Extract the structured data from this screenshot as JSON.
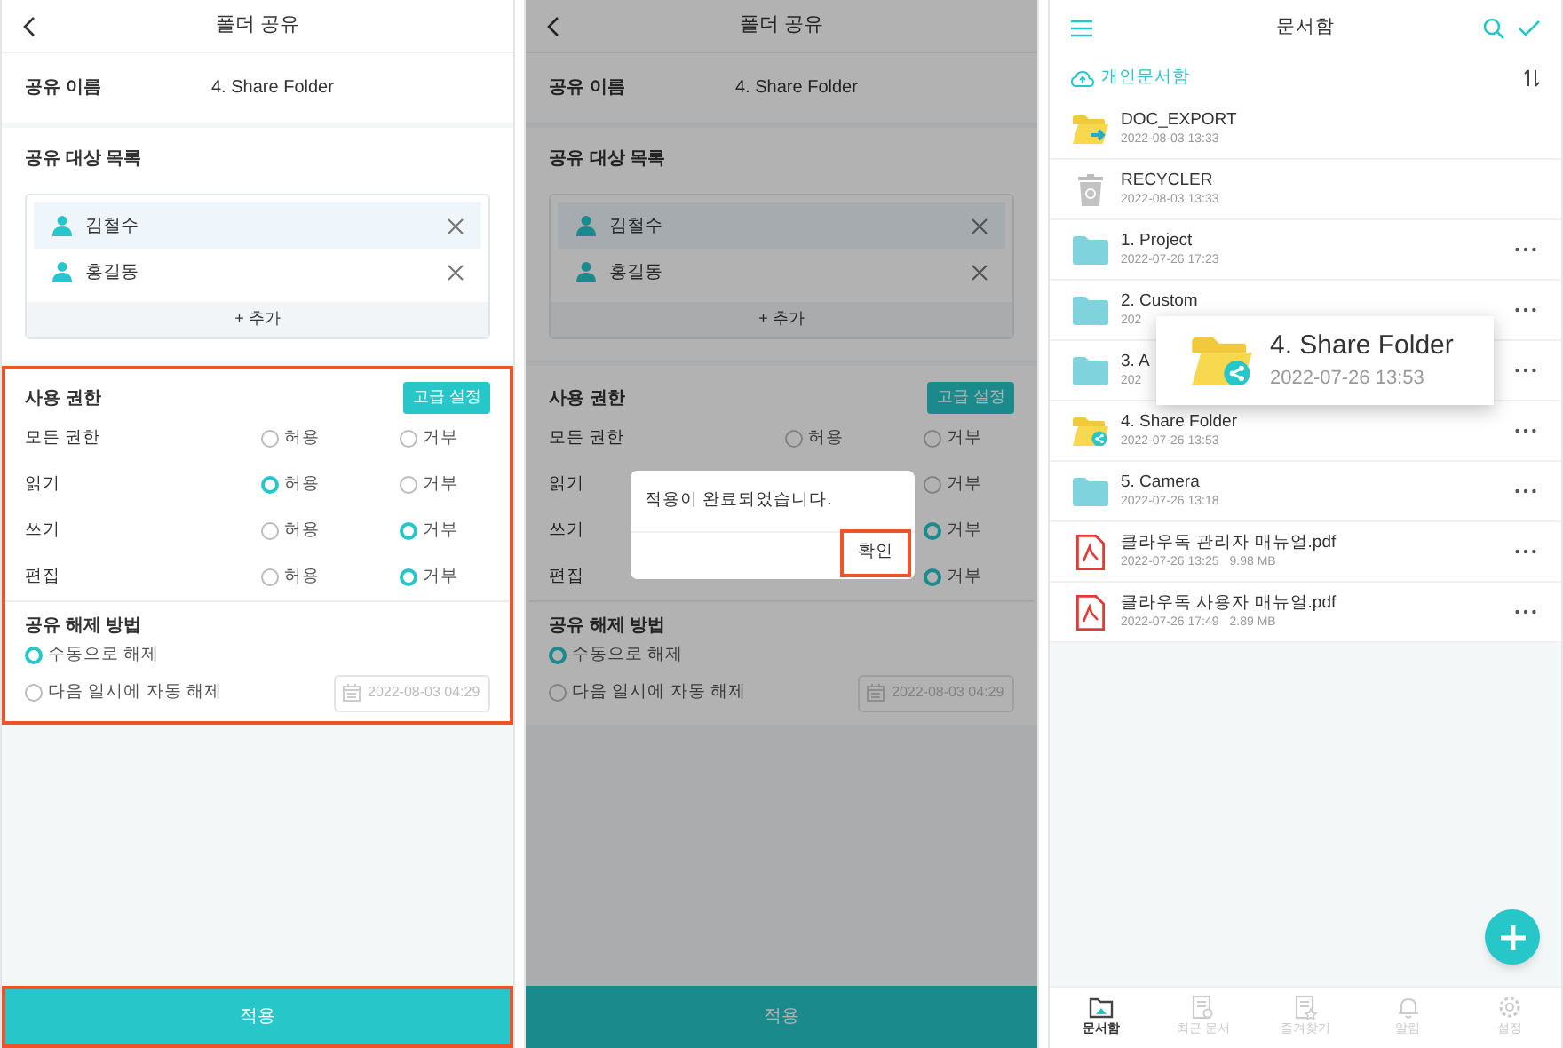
{
  "share_form": {
    "title": "폴더 공유",
    "name_label": "공유 이름",
    "name_value": "4. Share Folder",
    "targets_label": "공유 대상 목록",
    "targets": [
      {
        "name": "김철수",
        "selected": true
      },
      {
        "name": "홍길동",
        "selected": false
      }
    ],
    "add_label": "+ 추가",
    "permissions_label": "사용 권한",
    "advanced_button": "고급 설정",
    "permissions_highlighted": true,
    "permissions": [
      {
        "label": "모든 권한",
        "allow": {
          "label": "허용",
          "selected": false
        },
        "deny": {
          "label": "거부",
          "selected": false
        }
      },
      {
        "label": "읽기",
        "allow": {
          "label": "허용",
          "selected": true
        },
        "deny": {
          "label": "거부",
          "selected": false
        }
      },
      {
        "label": "쓰기",
        "allow": {
          "label": "허용",
          "selected": false
        },
        "deny": {
          "label": "거부",
          "selected": true
        }
      },
      {
        "label": "편집",
        "allow": {
          "label": "허용",
          "selected": false
        },
        "deny": {
          "label": "거부",
          "selected": true
        }
      }
    ],
    "release_label": "공유 해제 방법",
    "release_options": [
      {
        "label": "수동으로 해제",
        "selected": true
      },
      {
        "label": "다음 일시에 자동 해제",
        "selected": false
      }
    ],
    "release_date": "2022-08-03 04:29",
    "apply_button": "적용",
    "apply_highlighted": true
  },
  "share_form_confirm": {
    "title": "폴더 공유",
    "name_label": "공유 이름",
    "name_value": "4. Share Folder",
    "targets_label": "공유 대상 목록",
    "targets": [
      {
        "name": "김철수",
        "selected": true
      },
      {
        "name": "홍길동",
        "selected": false
      }
    ],
    "add_label": "+ 추가",
    "permissions_label": "사용 권한",
    "advanced_button": "고급 설정",
    "permissions_highlighted": false,
    "permissions": [
      {
        "label": "모든 권한",
        "allow": {
          "label": "허용",
          "selected": false
        },
        "deny": {
          "label": "거부",
          "selected": false
        }
      },
      {
        "label": "읽기",
        "deny": {
          "label": "거부",
          "selected": false
        }
      },
      {
        "label": "쓰기",
        "deny": {
          "label": "거부",
          "selected": true
        }
      },
      {
        "label": "편집",
        "deny": {
          "label": "거부",
          "selected": true
        }
      }
    ],
    "release_label": "공유 해제 방법",
    "release_options": [
      {
        "label": "수동으로 해제",
        "selected": true
      },
      {
        "label": "다음 일시에 자동 해제",
        "selected": false
      }
    ],
    "release_date": "2022-08-03 04:29",
    "apply_button": "적용",
    "apply_highlighted": false,
    "dialog": {
      "message": "적용이 완료되었습니다.",
      "confirm_button": "확인",
      "confirm_highlighted": true
    }
  },
  "documents": {
    "title": "문서함",
    "location": "개인문서함",
    "items": [
      {
        "kind": "export",
        "name": "DOC_EXPORT",
        "meta": "2022-08-03 13:33",
        "menu": false
      },
      {
        "kind": "trash",
        "name": "RECYCLER",
        "meta": "2022-08-03 13:33",
        "menu": false
      },
      {
        "kind": "folder",
        "name": "1. Project",
        "meta": "2022-07-26 17:23",
        "menu": true
      },
      {
        "kind": "folder",
        "name": "2. Custom",
        "meta": "202",
        "menu": true
      },
      {
        "kind": "folder",
        "name": "3. A",
        "meta": "202",
        "menu": true
      },
      {
        "kind": "shared",
        "name": "4. Share Folder",
        "meta": "2022-07-26 13:53",
        "menu": true
      },
      {
        "kind": "folder",
        "name": "5. Camera",
        "meta": "2022-07-26 13:18",
        "menu": true
      },
      {
        "kind": "pdf",
        "name": "클라우독 관리자 매뉴얼.pdf",
        "meta": "2022-07-26 13:25",
        "size": "9.98 MB",
        "menu": true
      },
      {
        "kind": "pdf",
        "name": "클라우독 사용자 매뉴얼.pdf",
        "meta": "2022-07-26 17:49",
        "size": "2.89 MB",
        "menu": true
      }
    ],
    "callout": {
      "name": "4. Share Folder",
      "meta": "2022-07-26 13:53"
    },
    "nav": [
      {
        "label": "문서함",
        "kind": "folder",
        "selected": true
      },
      {
        "label": "최근 문서",
        "kind": "recent",
        "selected": false
      },
      {
        "label": "즐겨찾기",
        "kind": "star",
        "selected": false
      },
      {
        "label": "알림",
        "kind": "bell",
        "selected": false
      },
      {
        "label": "설정",
        "kind": "gear",
        "selected": false
      }
    ]
  }
}
